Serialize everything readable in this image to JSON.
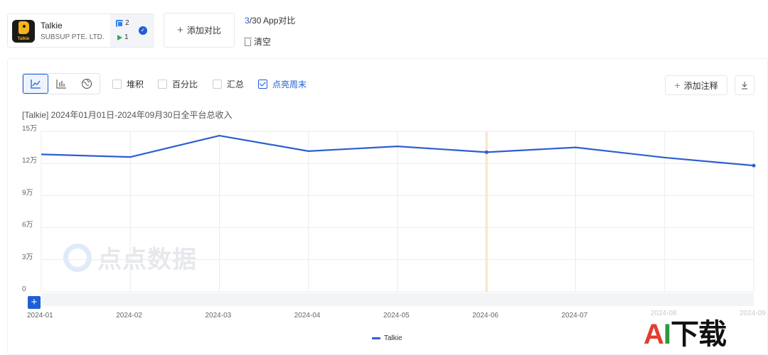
{
  "app_card": {
    "name": "Talkie",
    "developer": "SUBSUP PTE. LTD.",
    "icon_text": "Talkie",
    "ios_count": "2",
    "gp_count": "1"
  },
  "toolbar": {
    "add_compare_label": "添加对比",
    "compare_current": "3",
    "compare_rest": "/30 App对比",
    "clear_label": "清空"
  },
  "options": {
    "stack_label": "堆积",
    "percent_label": "百分比",
    "total_label": "汇总",
    "weekend_label": "点亮周末",
    "add_note_label": "添加注释"
  },
  "watermark_text": "点点数据",
  "brand_logo": {
    "a": "A",
    "i": "I",
    "rest": "下载"
  },
  "chart_data": {
    "type": "line",
    "title": "[Talkie] 2024年01月01日-2024年09月30日全平台总收入",
    "x": [
      "2024-01",
      "2024-02",
      "2024-03",
      "2024-04",
      "2024-05",
      "2024-06",
      "2024-07",
      "2024-08",
      "2024-09"
    ],
    "series": [
      {
        "name": "Talkie",
        "color": "#2c5fd0",
        "values": [
          128500,
          126000,
          146000,
          131500,
          136000,
          130500,
          135000,
          125500,
          118000
        ]
      }
    ],
    "ylim": [
      0,
      150000
    ],
    "yticks": [
      "0",
      "3万",
      "6万",
      "9万",
      "12万",
      "15万"
    ],
    "grid": true,
    "highlight_x": "2024-06",
    "legend": "bottom-center"
  }
}
